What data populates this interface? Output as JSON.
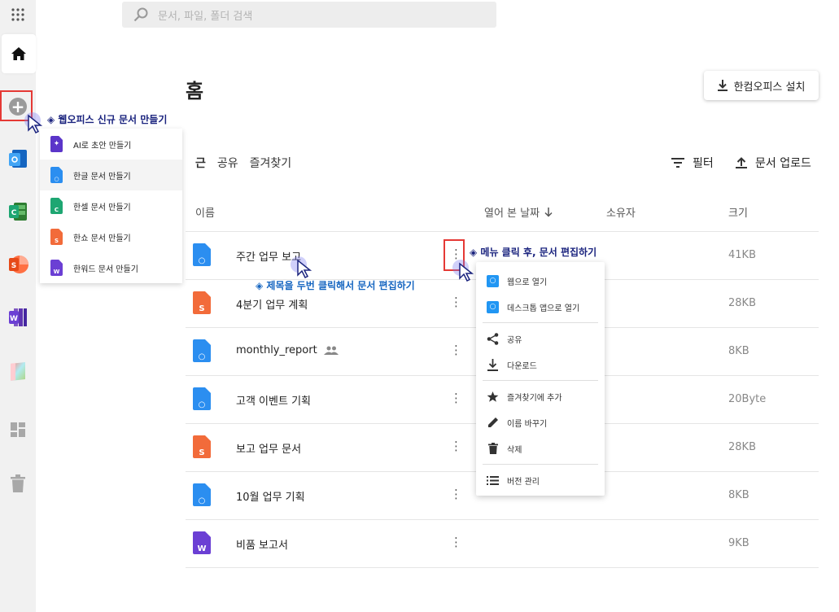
{
  "search": {
    "placeholder": "문서, 파일, 폴더 검색"
  },
  "page": {
    "title": "홈"
  },
  "install_button": {
    "label": "한컴오피스 설치"
  },
  "tabs": [
    {
      "label": "근",
      "active": true
    },
    {
      "label": "공유",
      "active": false
    },
    {
      "label": "즐겨찾기",
      "active": false
    }
  ],
  "toolbar": {
    "filter_label": "필터",
    "upload_label": "문서 업로드"
  },
  "columns": {
    "name": "이름",
    "opened": "열어 본 날짜",
    "owner": "소유자",
    "size": "크기"
  },
  "files": [
    {
      "name": "주간 업무 보고",
      "type": "hwp",
      "size": "41KB",
      "shared": false
    },
    {
      "name": "4분기 업무 계획",
      "type": "show",
      "size": "28KB",
      "shared": false
    },
    {
      "name": "monthly_report",
      "type": "hwp",
      "size": "8KB",
      "shared": true
    },
    {
      "name": "고객 이벤트 기획",
      "type": "hwp",
      "size": "20Byte",
      "shared": false
    },
    {
      "name": "보고 업무 문서",
      "type": "show",
      "size": "28KB",
      "shared": false
    },
    {
      "name": "10월 업무 기획",
      "type": "hwp",
      "size": "8KB",
      "shared": false
    },
    {
      "name": "비품 보고서",
      "type": "word",
      "size": "9KB",
      "shared": false
    }
  ],
  "create_menu": {
    "items": [
      {
        "label": "AI로 초안 만들기"
      },
      {
        "label": "한글 문서 만들기"
      },
      {
        "label": "한셀 문서 만들기"
      },
      {
        "label": "한쇼 문서 만들기"
      },
      {
        "label": "한워드 문서 만들기"
      }
    ]
  },
  "context_menu": {
    "open_web": "웹으로 열기",
    "open_desktop": "데스크톱 앱으로 열기",
    "share": "공유",
    "download": "다운로드",
    "favorite": "즐겨찾기에 추가",
    "rename": "이름 바꾸기",
    "delete": "삭제",
    "version": "버전 관리"
  },
  "annotations": {
    "create": "◈ 웹오피스 신규 문서 만들기",
    "menu": "◈ 메뉴 클릭 후, 문서 편집하기",
    "dblclick": "◈ 제목을 두번 클릭해서 문서 편집하기"
  },
  "colors": {
    "hwp": "#2b8ef0",
    "show": "#f26b3a",
    "cell": "#1ea672",
    "word": "#6b3fd4",
    "ai": "#5b35c9"
  }
}
